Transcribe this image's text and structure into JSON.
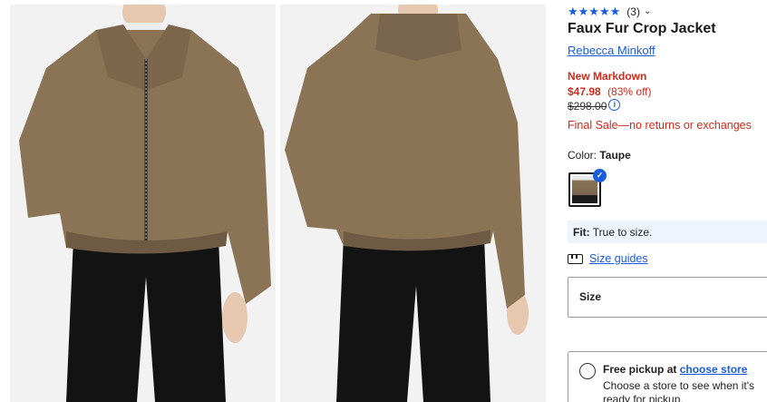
{
  "gallery": {
    "front_alt": "Faux Fur Crop Jacket front view",
    "back_alt": "Faux Fur Crop Jacket back view",
    "colors": {
      "fur": "#8b7356",
      "fur_shade": "#6f5b44",
      "pants": "#131313",
      "skin": "#e6c7b0",
      "background": "#f2f2f2"
    }
  },
  "product": {
    "stars": "★★★★★",
    "rating_count": "(3)",
    "title": "Faux Fur Crop Jacket",
    "brand": "Rebecca Minkoff",
    "markdown_label": "New Markdown",
    "sale_price": "$47.98",
    "discount": "(83% off)",
    "original_price": "$298.00",
    "final_sale": "Final Sale—no returns or exchanges"
  },
  "color": {
    "label": "Color:",
    "value": "Taupe"
  },
  "fit": {
    "label": "Fit:",
    "value": "True to size."
  },
  "size": {
    "guides_link": "Size guides",
    "select_label": "Size"
  },
  "pickup": {
    "title_prefix": "Free pickup at",
    "store_link": "choose store",
    "subtitle": "Choose a store to see when it's ready for pickup."
  },
  "theme": {
    "accent": "#1a5cde",
    "sale_red": "#d12a1b",
    "fit_bg": "#eef4fc"
  }
}
